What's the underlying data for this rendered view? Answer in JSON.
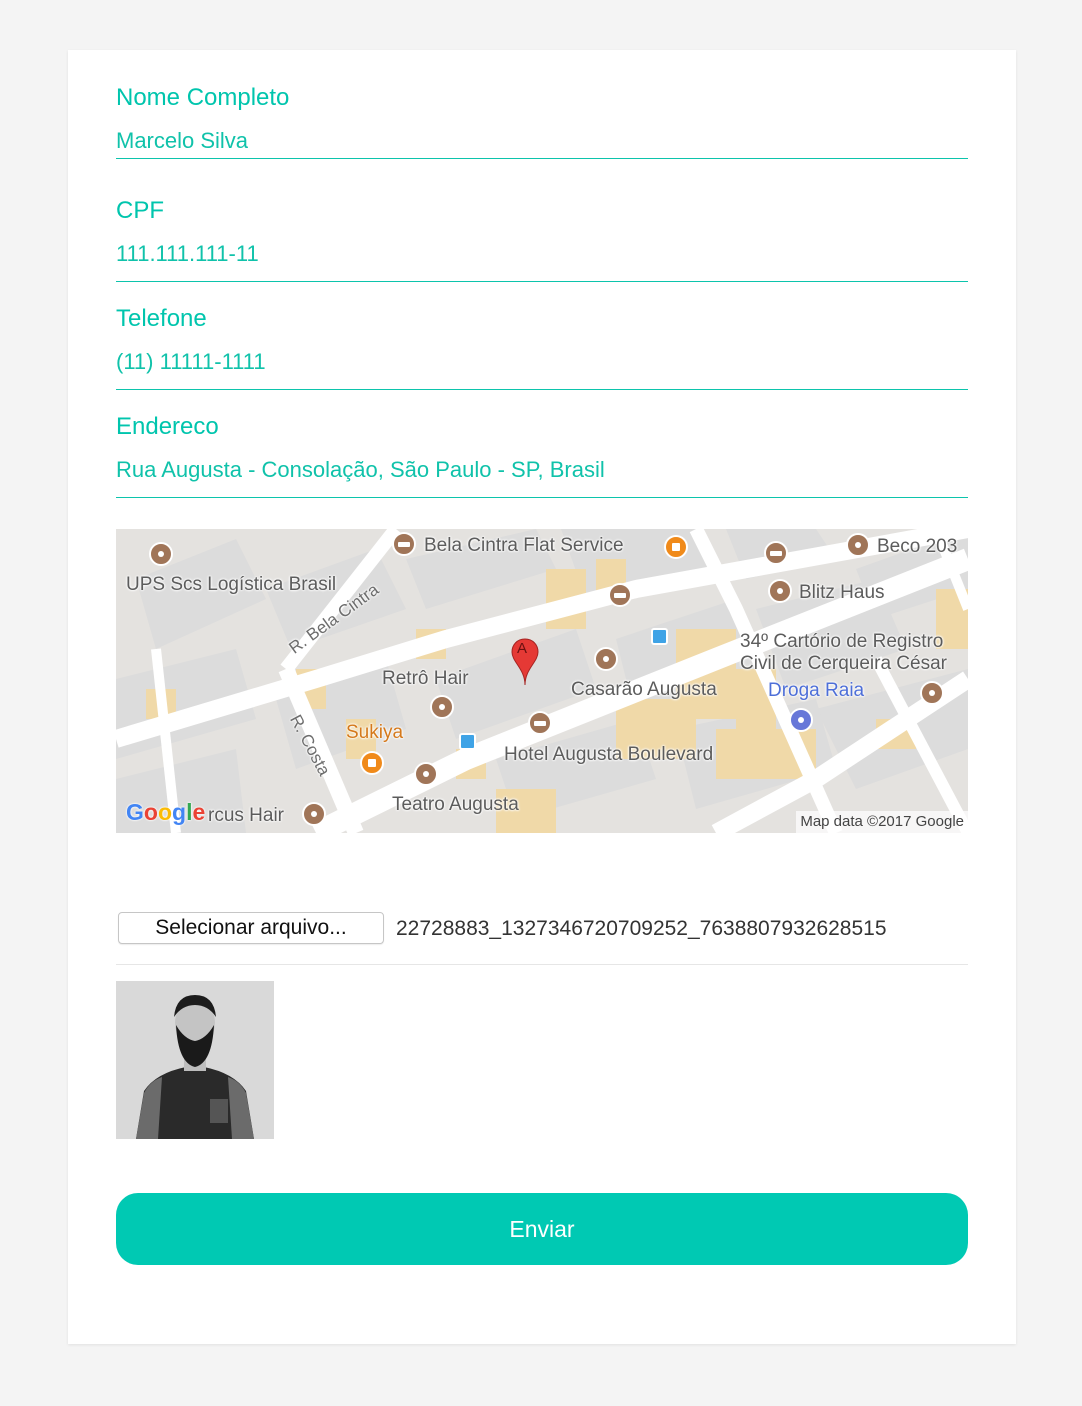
{
  "form": {
    "fields": [
      {
        "label": "Nome Completo",
        "value": "Marcelo Silva"
      },
      {
        "label": "CPF",
        "value": "111.111.111-11"
      },
      {
        "label": "Telefone",
        "value": "(11) 11111-1111"
      },
      {
        "label": "Endereco",
        "value": "Rua Augusta - Consolação, São Paulo - SP, Brasil"
      }
    ],
    "accent_color": "#00c5ad",
    "button_color": "#00c9b3"
  },
  "map": {
    "marker_letter": "A",
    "labels": {
      "ups": "UPS Scs Logística Brasil",
      "bela_cintra_flat": "Bela Cintra Flat Service",
      "beco": "Beco 203",
      "blitz": "Blitz Haus",
      "cartorio_1": "34º Cartório de Registro",
      "cartorio_2": "Civil de Cerqueira César",
      "droga_raia": "Droga Raia",
      "casarao": "Casarão Augusta",
      "retro": "Retrô Hair",
      "sukiya": "Sukiya",
      "hotel": "Hotel Augusta Boulevard",
      "teatro": "Teatro Augusta",
      "hair": "rcus Hair",
      "street_bela_cintra": "R. Bela Cintra",
      "street_costa": "R. Costa"
    },
    "google_logo": "Google",
    "attribution": "Map data ©2017 Google"
  },
  "file_input": {
    "button_label": "Selecionar arquivo...",
    "file_name": "22728883_1327346720709252_7638807932628515"
  },
  "submit": {
    "label": "Enviar"
  }
}
